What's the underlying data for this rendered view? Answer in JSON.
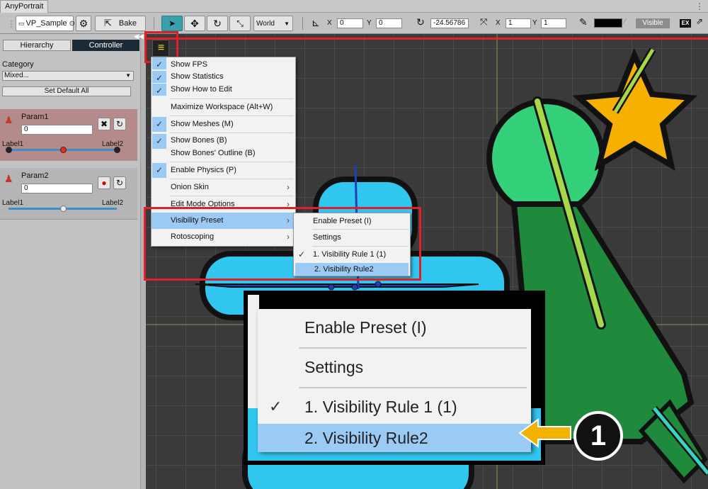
{
  "window": {
    "title": "AnyPortrait"
  },
  "toolbar": {
    "portrait_name": "VP_Sample",
    "bake_label": "Bake",
    "space_value": "World",
    "pos_x_label": "X",
    "pos_x": "0",
    "pos_y_label": "Y",
    "pos_y": "0",
    "rotation": "-24.56786",
    "scale_x_label": "X",
    "scale_x": "1",
    "scale_y_label": "Y",
    "scale_y": "1",
    "visible_label": "Visible",
    "ex_label": "EX"
  },
  "left_panel": {
    "tabs": [
      "Hierarchy",
      "Controller"
    ],
    "category_label": "Category",
    "category_value": "Mixed...",
    "set_default_label": "Set Default All",
    "params": [
      {
        "name": "Param1",
        "value": "0",
        "label_left": "Label1",
        "label_right": "Label2",
        "level": 0.5
      },
      {
        "name": "Param2",
        "value": "0",
        "label_left": "Label1",
        "label_right": "Label2",
        "level": 0.5
      }
    ]
  },
  "main_menu": {
    "items": [
      {
        "label": "Show FPS",
        "checked": true
      },
      {
        "label": "Show Statistics",
        "checked": true
      },
      {
        "label": "Show How to Edit",
        "checked": true
      },
      {
        "label": "Maximize Workspace (Alt+W)",
        "checked": false
      },
      {
        "label": "Show Meshes (M)",
        "checked": true
      },
      {
        "label": "Show Bones (B)",
        "checked": true
      },
      {
        "label": "Show Bones' Outline (B)",
        "checked": false
      },
      {
        "label": "Enable Physics (P)",
        "checked": true
      },
      {
        "label": "Onion Skin",
        "submenu": true
      },
      {
        "label": "Edit Mode Options",
        "submenu": true
      },
      {
        "label": "Visibility Preset",
        "submenu": true,
        "highlighted": true
      },
      {
        "label": "Rotoscoping",
        "submenu": true
      }
    ]
  },
  "submenu": {
    "items": [
      {
        "label": "Enable Preset (I)"
      },
      {
        "label": "Settings"
      },
      {
        "label": "1. Visibility Rule 1 (1)",
        "checked": true
      },
      {
        "label": "2. Visibility Rule2",
        "highlighted": true
      }
    ]
  },
  "callout": {
    "number": "1"
  },
  "colors": {
    "highlight_box": "#e01f26",
    "menu_highlight": "#9bcbf5",
    "accent_arrow": "#f2b200"
  }
}
